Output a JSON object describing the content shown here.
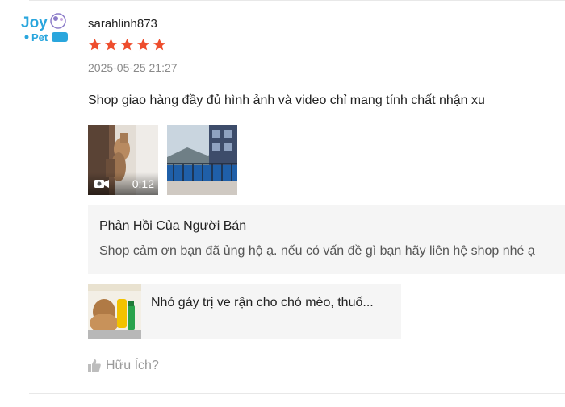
{
  "review": {
    "username": "sarahlinh873",
    "rating": 5,
    "rating_max": 5,
    "datetime": "2025-05-25 21:27",
    "text": "Shop giao hàng đầy đủ hình ảnh và video chỉ mang tính chất nhận xu",
    "star_color": "#ee4d2d"
  },
  "avatar": {
    "brand_top": "Joy",
    "brand_bottom": "Pet",
    "icon": "joy-pet-logo"
  },
  "media": [
    {
      "type": "video",
      "duration": "0:12",
      "icon": "video-camera-icon"
    },
    {
      "type": "image"
    }
  ],
  "seller_reply": {
    "title": "Phản Hồi Của Người Bán",
    "text": "Shop cảm ơn bạn đã ủng hộ ạ. nếu có vấn đề gì bạn hãy liên hệ shop nhé ạ"
  },
  "product": {
    "name": "Nhỏ gáy trị ve rận cho chó mèo, thuố..."
  },
  "helpful": {
    "label": "Hữu Ích?",
    "icon": "thumbs-up-icon"
  }
}
